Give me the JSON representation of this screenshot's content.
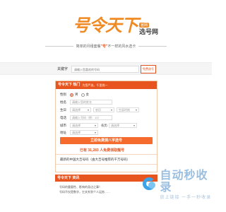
{
  "header": {
    "logo_text": "号令天下",
    "logo_badge": "官网",
    "logo_sub": "选号网",
    "slogan_left": "简单的月租套餐",
    "slogan_quote": "\"号\"",
    "slogan_right": "不一样的风水选卡"
  },
  "search": {
    "label": "关键字",
    "placeholder": "请输入您喜欢的号码",
    "button": "免费选号"
  },
  "form": {
    "title": "号令天下 热门",
    "note": "为您严选，千里挑一",
    "gender_label": "性别",
    "gender_options": [
      "男",
      "女"
    ],
    "name_label": "姓名",
    "name_placeholder": "请输入您的姓名",
    "birth_label": "生日",
    "birth_year": "请选择",
    "birth_month": "农历",
    "birth_day": "生辰时刻",
    "phone_label": "电话",
    "phone_placeholder": "请输入号码（例：13）",
    "city_label": "城市",
    "city_value": "请选择",
    "region_value": "请选择",
    "addr_label": "地址",
    "addr_value": "请选择",
    "submit": "立即免费测八字选号",
    "tip": "已有 31,283 人免费领取靓号",
    "sub_title": "最新的中国大吉号码（由大吉号推荐的千万号码）"
  },
  "panel2": {
    "title": "号令天下 资讯",
    "line1": "号码的重要性、影响的身边之事！",
    "line2": "号码不仅是数字，它关系到个人运势……"
  },
  "watermark": {
    "big": "自动秒收录",
    "small": "放上链接 一手一秒收录"
  },
  "colors": {
    "brand": "#e8541d",
    "logo": "#f08a24"
  }
}
